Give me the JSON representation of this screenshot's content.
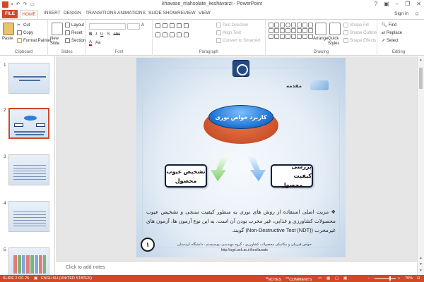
{
  "window": {
    "title": "khavase_mahsolate_keshavarzi - PowerPoint",
    "minimize": "–",
    "restore": "❐",
    "close": "✕"
  },
  "tabs": {
    "file": "FILE",
    "items": [
      "HOME",
      "INSERT",
      "DESIGN",
      "TRANSITIONS",
      "ANIMATIONS",
      "SLIDE SHOW",
      "REVIEW",
      "VIEW"
    ],
    "signin": "Sign in"
  },
  "ribbon": {
    "clipboard": {
      "label": "Clipboard",
      "paste": "Paste",
      "cut": "Cut",
      "copy": "Copy",
      "format_painter": "Format Painter"
    },
    "slides": {
      "label": "Slides",
      "new_slide": "New Slide",
      "layout": "Layout",
      "reset": "Reset",
      "section": "Section"
    },
    "font": {
      "label": "Font"
    },
    "paragraph": {
      "label": "Paragraph",
      "text_direction": "Text Direction",
      "align_text": "Align Text",
      "convert_smartart": "Convert to SmartArt"
    },
    "drawing": {
      "label": "Drawing",
      "arrange": "Arrange",
      "quick_styles": "Quick Styles",
      "shape_fill": "Shape Fill",
      "shape_outline": "Shape Outline",
      "shape_effects": "Shape Effects"
    },
    "editing": {
      "label": "Editing",
      "find": "Find",
      "replace": "Replace",
      "select": "Select"
    }
  },
  "slide_panel": {
    "numbers": [
      "1",
      "2",
      "3",
      "4",
      "5"
    ],
    "selected": 2
  },
  "slide": {
    "intro_label": "مقدمه",
    "center_title": "کاربرد خواص نوری",
    "box_left_line1": "تشخیص عیوب",
    "box_left_line2": "محصول",
    "box_right_line1": "بررسی کیفیت",
    "box_right_line2": "محصول",
    "body": "❖ مزیت اصلی استفاده از روش های نوری به منظور کیفیت سنجی و تشخیص عیوب محصولات کشاورزی و غذایی، غیر مخرب بودن آن است. به این نوع آزمون ها، آزمون های غیرمخرب (Non-Destructive Test (NDT)) گویند.",
    "slide_number": "۱",
    "footer_line1": "خواص فیزیکی و مکانیکی محصولات کشاورزی - گروه مهندسی بیوسیستم - دانشگاه کردستان",
    "footer_line2": "http://agri.uok.ac.ir/knollazade"
  },
  "notes": {
    "placeholder": "Click to add notes"
  },
  "status": {
    "slide_of": "SLIDE 2 OF 25",
    "language": "ENGLISH (UNITED STATES)",
    "notes": "NOTES",
    "comments": "COMMENTS",
    "zoom": "70%"
  },
  "colors": {
    "accent": "#d24726",
    "slide_blue": "#1a6fd0"
  }
}
